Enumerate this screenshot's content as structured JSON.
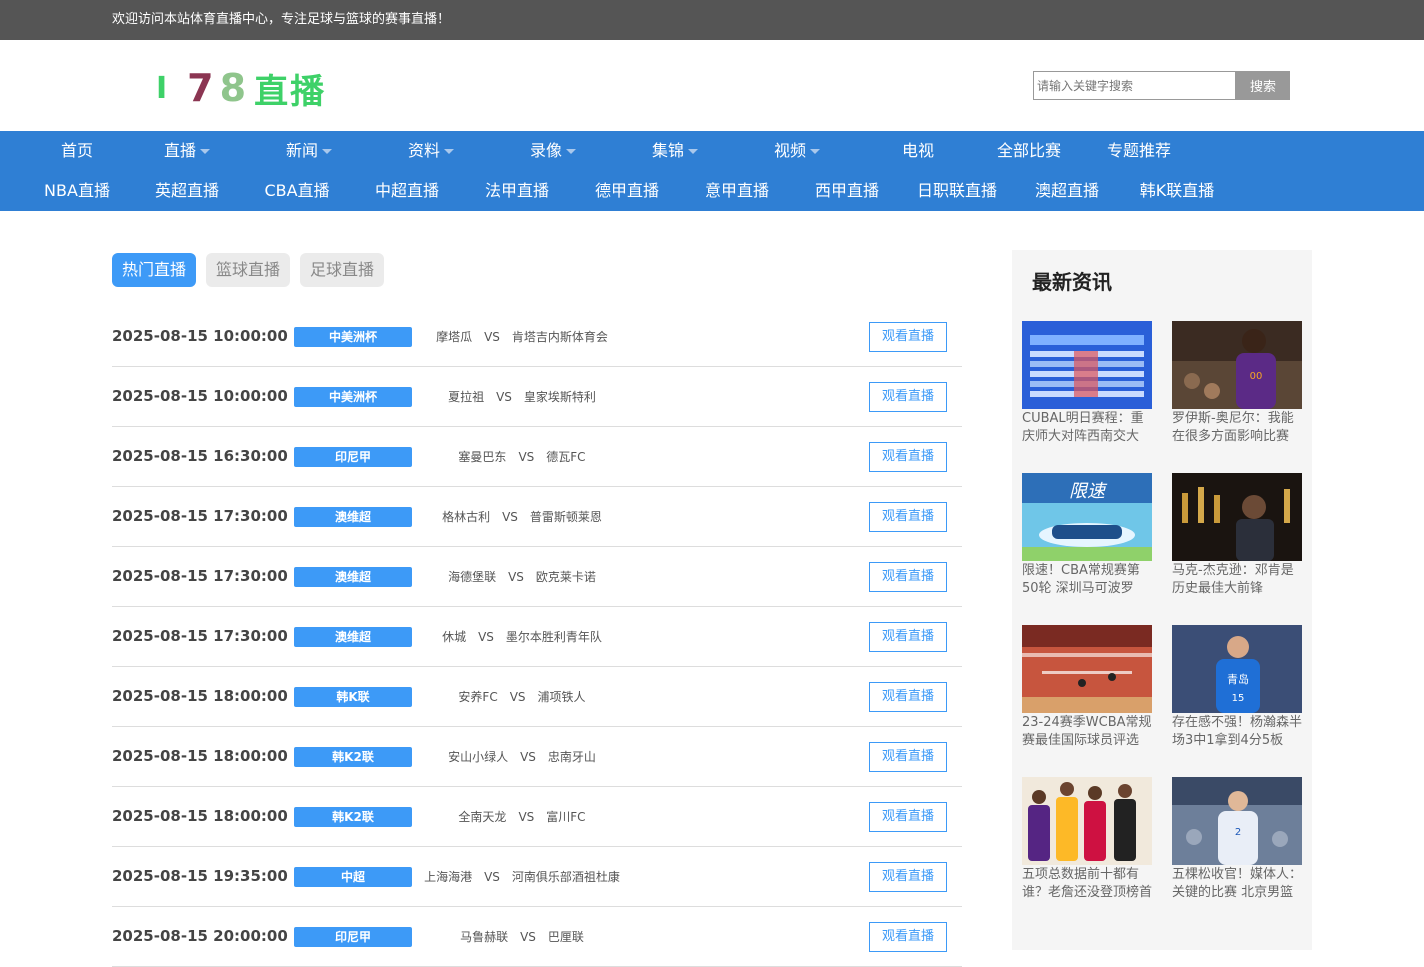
{
  "topbar": {
    "welcome": "欢迎访问本站体育直播中心，专注足球与篮球的赛事直播！"
  },
  "logo": {
    "c1": "I",
    "c2": "7",
    "c3": "8",
    "c4": "直播"
  },
  "search": {
    "placeholder": "请输入关键字搜索",
    "button": "搜索"
  },
  "nav": {
    "row1": [
      {
        "label": "首页",
        "has_caret": false
      },
      {
        "label": "直播",
        "has_caret": true
      },
      {
        "label": "新闻",
        "has_caret": true
      },
      {
        "label": "资料",
        "has_caret": true
      },
      {
        "label": "录像",
        "has_caret": true
      },
      {
        "label": "集锦",
        "has_caret": true
      },
      {
        "label": "视频",
        "has_caret": true
      },
      {
        "label": "电视",
        "has_caret": false
      },
      {
        "label": "全部比赛",
        "has_caret": false
      },
      {
        "label": "专题推荐",
        "has_caret": false
      }
    ],
    "row2": [
      "NBA直播",
      "英超直播",
      "CBA直播",
      "中超直播",
      "法甲直播",
      "德甲直播",
      "意甲直播",
      "西甲直播",
      "日职联直播",
      "澳超直播",
      "韩K联直播"
    ]
  },
  "tabs": [
    "热门直播",
    "篮球直播",
    "足球直播"
  ],
  "matches": [
    {
      "time": "2025-08-15 10:00:00",
      "league": "中美洲杯",
      "home": "摩塔瓜",
      "vs": "VS",
      "away": "肯塔吉内斯体育会",
      "action": "观看直播"
    },
    {
      "time": "2025-08-15 10:00:00",
      "league": "中美洲杯",
      "home": "夏拉祖",
      "vs": "VS",
      "away": "皇家埃斯特利",
      "action": "观看直播"
    },
    {
      "time": "2025-08-15 16:30:00",
      "league": "印尼甲",
      "home": "塞曼巴东",
      "vs": "VS",
      "away": "德瓦FC",
      "action": "观看直播"
    },
    {
      "time": "2025-08-15 17:30:00",
      "league": "澳维超",
      "home": "格林古利",
      "vs": "VS",
      "away": "普雷斯顿莱恩",
      "action": "观看直播"
    },
    {
      "time": "2025-08-15 17:30:00",
      "league": "澳维超",
      "home": "海德堡联",
      "vs": "VS",
      "away": "欧克莱卡诺",
      "action": "观看直播"
    },
    {
      "time": "2025-08-15 17:30:00",
      "league": "澳维超",
      "home": "休城",
      "vs": "VS",
      "away": "墨尔本胜利青年队",
      "action": "观看直播"
    },
    {
      "time": "2025-08-15 18:00:00",
      "league": "韩K联",
      "home": "安养FC",
      "vs": "VS",
      "away": "浦项铁人",
      "action": "观看直播"
    },
    {
      "time": "2025-08-15 18:00:00",
      "league": "韩K2联",
      "home": "安山小绿人",
      "vs": "VS",
      "away": "忠南牙山",
      "action": "观看直播"
    },
    {
      "time": "2025-08-15 18:00:00",
      "league": "韩K2联",
      "home": "全南天龙",
      "vs": "VS",
      "away": "富川FC",
      "action": "观看直播"
    },
    {
      "time": "2025-08-15 19:35:00",
      "league": "中超",
      "home": "上海海港",
      "vs": "VS",
      "away": "河南俱乐部酒祖杜康",
      "action": "观看直播"
    },
    {
      "time": "2025-08-15 20:00:00",
      "league": "印尼甲",
      "home": "马鲁赫联",
      "vs": "VS",
      "away": "巴厘联",
      "action": "观看直播"
    }
  ],
  "sidebar": {
    "title": "最新资讯",
    "news": [
      {
        "caption": "CUBAL明日赛程：重庆师大对阵西南交大",
        "thumb": "schedule-graphic"
      },
      {
        "caption": "罗伊斯-奥尼尔：我能在很多方面影响比赛",
        "thumb": "suns-player-photo"
      },
      {
        "caption": "限速！CBA常规赛第50轮 深圳马可波罗",
        "thumb": "racing-car-poster"
      },
      {
        "caption": "马克-杰克逊：邓肯是历史最佳大前锋",
        "thumb": "trophy-room-photo"
      },
      {
        "caption": "23-24赛季WCBA常规赛最佳国际球员评选",
        "thumb": "basketball-court-photo"
      },
      {
        "caption": "存在感不强！杨瀚森半场3中1拿到4分5板",
        "thumb": "qingdao-player-photo"
      },
      {
        "caption": "五项总数据前十都有谁？老詹还没登顶榜首",
        "thumb": "nba-legends-collage"
      },
      {
        "caption": "五棵松收官！媒体人：关键的比赛 北京男篮",
        "thumb": "beijing-player-photo"
      }
    ]
  },
  "colors": {
    "accent": "#3d9af7",
    "nav": "#2f7fd4",
    "topbar": "#555555"
  }
}
